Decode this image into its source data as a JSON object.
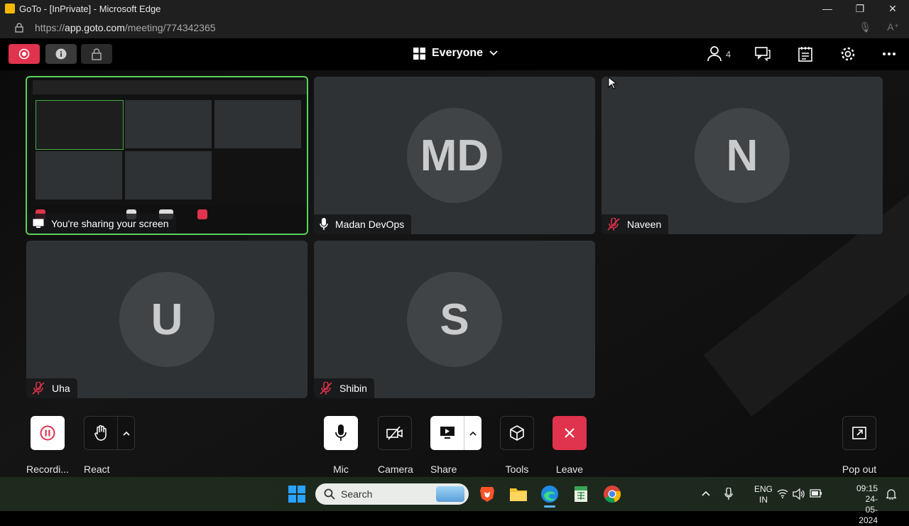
{
  "browser": {
    "title": "GoTo - [InPrivate] - Microsoft Edge",
    "url_prefix": "https://",
    "url_host": "app.goto.com",
    "url_path": "/meeting/774342365"
  },
  "toolbar": {
    "view_label": "Everyone",
    "participant_count": "4"
  },
  "tiles": [
    {
      "name": "You're sharing your screen"
    },
    {
      "initials": "MD",
      "name": "Madan DevOps",
      "mic": "on"
    },
    {
      "initials": "N",
      "name": "Naveen",
      "mic": "muted"
    },
    {
      "initials": "U",
      "name": "Uha",
      "mic": "muted"
    },
    {
      "initials": "S",
      "name": "Shibin",
      "mic": "muted"
    }
  ],
  "controls": {
    "recording": "Recordi...",
    "react": "React",
    "mic": "Mic",
    "camera": "Camera",
    "share": "Share",
    "tools": "Tools",
    "leave": "Leave",
    "popout": "Pop out"
  },
  "colors": {
    "accent_red": "#e0334d",
    "share_border": "#5ad15a",
    "tile_bg": "#2f3234"
  },
  "taskbar": {
    "search_placeholder": "Search",
    "lang": "ENG",
    "region": "IN",
    "time": "09:15",
    "date": "24-05-2024"
  }
}
